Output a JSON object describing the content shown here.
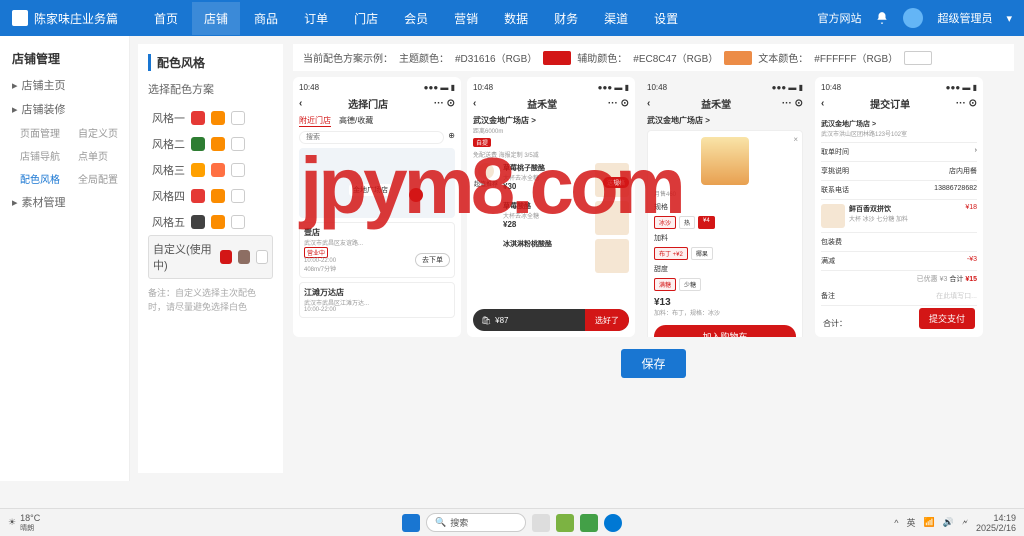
{
  "header": {
    "app_name": "陈家味庄业务篇",
    "nav": [
      "首页",
      "店铺",
      "商品",
      "订单",
      "门店",
      "会员",
      "营销",
      "数据",
      "财务",
      "渠道",
      "设置"
    ],
    "active_nav": 1,
    "official_site": "官方网站",
    "user_role": "超级管理员"
  },
  "sidebar": {
    "title": "店铺管理",
    "groups": [
      {
        "label": "店铺主页",
        "items": []
      },
      {
        "label": "店铺装修",
        "items": [
          {
            "l": "页面管理",
            "r": "自定义页"
          },
          {
            "l": "店铺导航",
            "r": "点单页"
          },
          {
            "l": "配色风格",
            "r": "全局配置",
            "active": true
          }
        ]
      },
      {
        "label": "素材管理",
        "items": []
      }
    ]
  },
  "page_title": "配色风格",
  "colorbar": {
    "prefix": "当前配色方案示例：",
    "theme_label": "主题颜色：",
    "theme_val": "#D31616（RGB）",
    "theme_color": "#D31616",
    "aux_label": "辅助颜色：",
    "aux_val": "#EC8C47（RGB）",
    "aux_color": "#EC8C47",
    "text_label": "文本颜色：",
    "text_val": "#FFFFFF（RGB）",
    "text_color": "#FFFFFF"
  },
  "schemes": {
    "label": "选择配色方案",
    "items": [
      {
        "name": "风格一",
        "c1": "#e53935",
        "c2": "#fb8c00"
      },
      {
        "name": "风格二",
        "c1": "#2e7d32",
        "c2": "#fb8c00"
      },
      {
        "name": "风格三",
        "c1": "#ffa000",
        "c2": "#ff7043"
      },
      {
        "name": "风格四",
        "c1": "#e53935",
        "c2": "#fb8c00"
      },
      {
        "name": "风格五",
        "c1": "#424242",
        "c2": "#fb8c00"
      },
      {
        "name": "自定义",
        "badge": "(使用中)",
        "c1": "#d31616",
        "c2": "#8d6e63",
        "active": true
      }
    ],
    "note": "备注：自定义选择主次配色时，请尽量避免选择白色"
  },
  "phones": {
    "time": "10:48",
    "p1": {
      "title": "选择门店",
      "tabs": [
        "附近门店",
        "高德/收藏"
      ],
      "search_ph": "搜索",
      "map_label": "金地广场店",
      "store1": {
        "name": "壹店",
        "addr": "武汉市武昌区友谊路...",
        "hours": "10:00-22:00",
        "dist": "408m/7分钟"
      },
      "store2": {
        "name": "江滩万达店",
        "addr": "武汉市武昌区江滩万达...",
        "hours": "10:00-22:00"
      },
      "btn": "去下单"
    },
    "p2": {
      "title": "益禾堂",
      "store": "武汉金地广场店 >",
      "dist": "距离6000m",
      "tags": "免配送费 海报定制 3/5减",
      "cat": "超值推荐",
      "prod1": {
        "name": "草莓桃子酸酪",
        "price": "¥30"
      },
      "prod2": {
        "name": "草莓酸酪",
        "sub": "大杯去冰全糖",
        "price": "¥28"
      },
      "prod3": {
        "name": "冰淇淋粉桃酸酪"
      },
      "badge": "送规格",
      "cart_total": "¥87",
      "cart_btn": "选好了"
    },
    "p3": {
      "title": "益禾堂",
      "store": "武汉金地广场店 >",
      "sub": "月售460",
      "spec_label": "规格",
      "specs": [
        "冰沙",
        "热",
        "¥4"
      ],
      "opt_label": "加料",
      "opts": [
        "布丁 +¥2",
        "椰果"
      ],
      "sweet": "满糖",
      "price": "¥13",
      "desc": "加料：布丁，规格：冰沙",
      "btn": "加入购物车"
    },
    "p4": {
      "title": "提交订单",
      "store": "武汉金地广场店 >",
      "addr": "武汉市洪山区团林路123号102室",
      "sec1": "取单时间",
      "sec2_l": "享挑说明",
      "sec2_r": "店内用餐",
      "sec3_l": "联系电话",
      "sec3_r": "13886728682",
      "prod": {
        "name": "鲜百香双拼饮",
        "sub": "大杯 冰沙 七分糖 加料",
        "price": "¥18"
      },
      "pack_l": "包装费",
      "dis_l": "满减",
      "dis_v": "-¥3",
      "saved": "已优惠 ¥3",
      "total_l": "合计",
      "total": "¥15",
      "remark": "备注",
      "remark_ph": "在此填写口...",
      "sum": "合计：",
      "btn": "提交支付"
    }
  },
  "save_btn": "保存",
  "taskbar": {
    "temp": "18°C",
    "weather": "晴朗",
    "search": "搜索",
    "time": "14:19",
    "date": "2025/2/16"
  },
  "watermark": "jpym8.com"
}
